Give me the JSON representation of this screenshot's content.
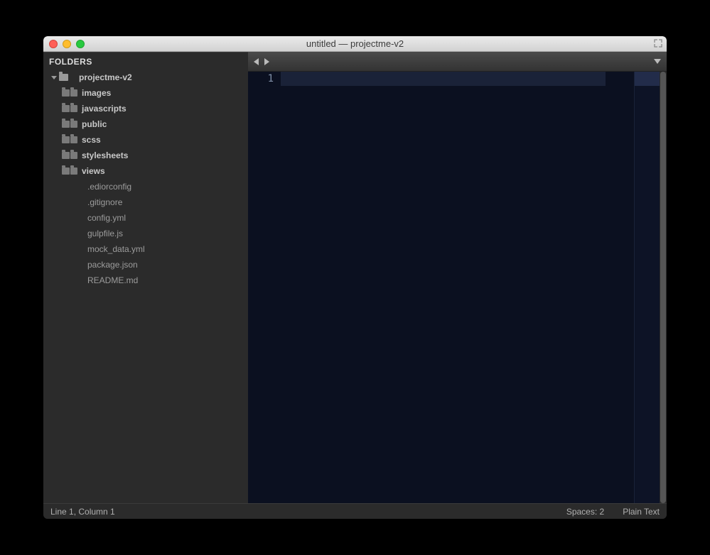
{
  "window": {
    "title": "untitled — projectme-v2"
  },
  "sidebar": {
    "header": "FOLDERS",
    "root": {
      "name": "projectme-v2"
    },
    "folders": [
      {
        "name": "images"
      },
      {
        "name": "javascripts"
      },
      {
        "name": "public"
      },
      {
        "name": "scss"
      },
      {
        "name": "stylesheets"
      },
      {
        "name": "views"
      }
    ],
    "files": [
      {
        "name": ".ediorconfig"
      },
      {
        "name": ".gitignore"
      },
      {
        "name": "config.yml"
      },
      {
        "name": "gulpfile.js"
      },
      {
        "name": "mock_data.yml"
      },
      {
        "name": "package.json"
      },
      {
        "name": "README.md"
      }
    ]
  },
  "editor": {
    "line_number": "1"
  },
  "status": {
    "cursor": "Line 1, Column 1",
    "spaces": "Spaces: 2",
    "syntax": "Plain Text"
  }
}
